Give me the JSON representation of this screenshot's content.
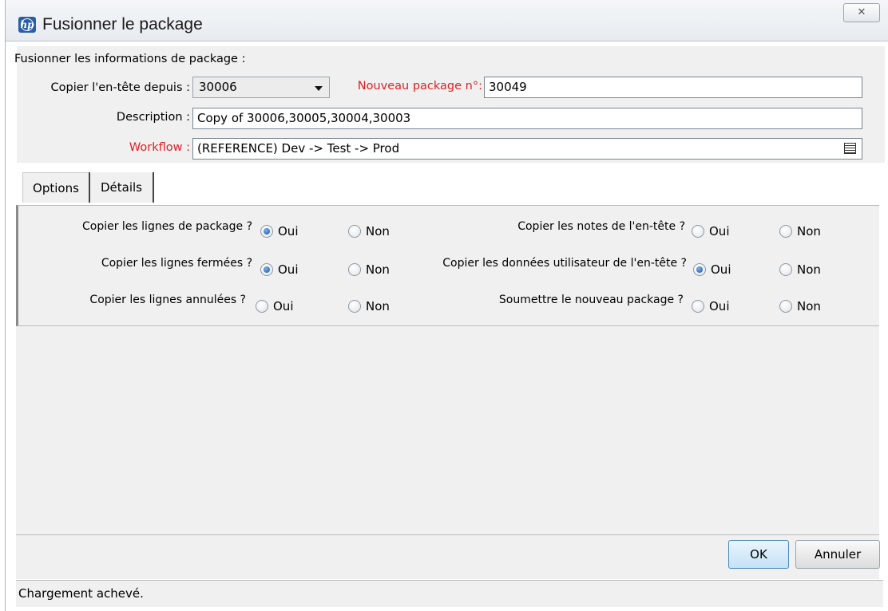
{
  "window": {
    "title": "Fusionner le package",
    "close_symbol": "ꟷ"
  },
  "header": {
    "section_title": "Fusionner les informations de package :",
    "copy_header_label": "Copier l'en-tête depuis :",
    "copy_header_value": "30006",
    "new_package_label": "Nouveau package n°:",
    "new_package_value": "30049",
    "description_label": "Description :",
    "description_value": "Copy of 30006,30005,30004,30003",
    "workflow_label": "Workflow :",
    "workflow_value": "(REFERENCE) Dev -> Test -> Prod"
  },
  "tabs": [
    {
      "label": "Options"
    },
    {
      "label": "Détails"
    }
  ],
  "options": {
    "yes": "Oui",
    "no": "Non",
    "left": [
      {
        "question": "Copier les lignes de package ?",
        "selected": "Oui"
      },
      {
        "question": "Copier les lignes fermées ?",
        "selected": "Oui"
      },
      {
        "question": "Copier les lignes annulées ?",
        "selected": ""
      }
    ],
    "right": [
      {
        "question": "Copier les notes de l'en-tête ?",
        "selected": ""
      },
      {
        "question": "Copier les données utilisateur de l'en-tête ?",
        "selected": "Oui"
      },
      {
        "question": "Soumettre le nouveau package ?",
        "selected": ""
      }
    ]
  },
  "buttons": {
    "ok": "OK",
    "cancel": "Annuler"
  },
  "status": {
    "text": "Chargement achevé."
  },
  "colors": {
    "required_label": "#e02020",
    "accent": "#2a5fa8"
  }
}
